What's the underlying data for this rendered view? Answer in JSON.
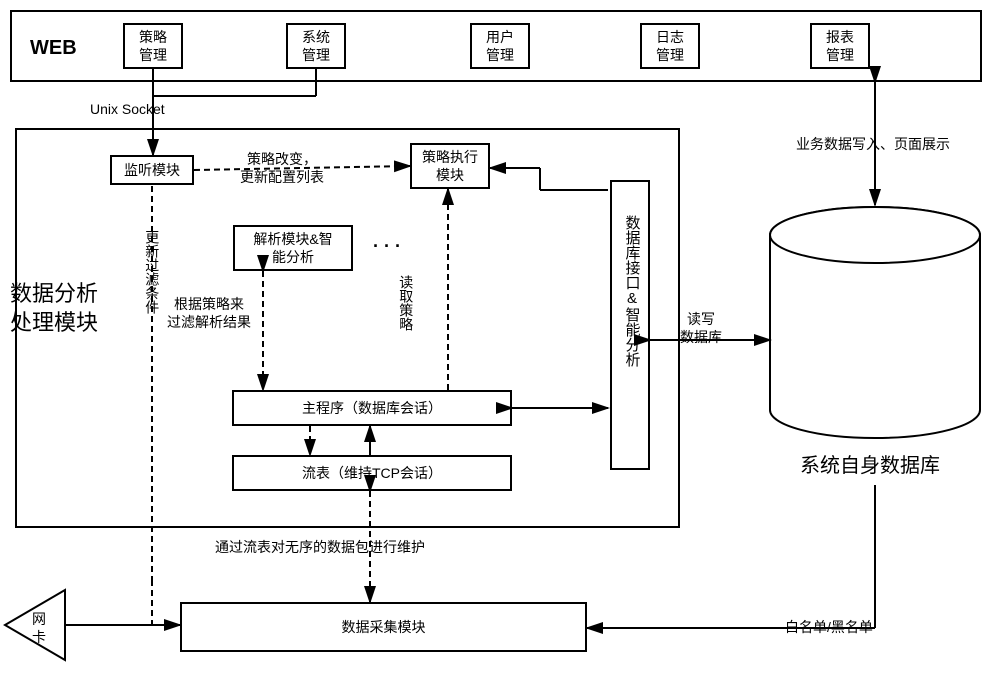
{
  "web": {
    "title": "WEB",
    "menu1": "策略\n管理",
    "menu2": "系统\n管理",
    "menu3": "用户\n管理",
    "menu4": "日志\n管理",
    "menu5": "报表\n管理"
  },
  "labels": {
    "unix_socket": "Unix Socket",
    "analysis_module": "数据分析\n处理模块",
    "listen": "监听模块",
    "policy_change": "策略改变，\n更新配置列表",
    "policy_exec": "策略执行\n模块",
    "parse": "解析模块&智\n能分析",
    "dots": "· · ·",
    "read_policy": "读取策略",
    "filter_result": "根据策略来\n过滤解析结果",
    "update_filter": "更新过滤条件",
    "main_program": "主程序（数据库会话）",
    "flow_table": "流表（维持TCP会话）",
    "flow_maintain": "通过流表对无序的数据包进行维护",
    "db_interface": "数据库接口&智能分析",
    "rw_db": "读写\n数据库",
    "own_db": "系统自身数据库",
    "biz_write": "业务数据写入、页面展示",
    "nic": "网\n卡",
    "collect": "数据采集模块",
    "whitelist": "白名单/黑名单"
  }
}
